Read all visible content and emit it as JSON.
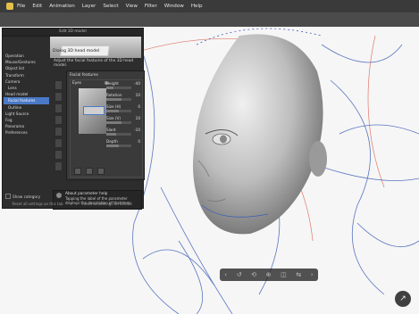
{
  "menu": [
    "File",
    "Edit",
    "Animation",
    "Layer",
    "Select",
    "View",
    "Filter",
    "Window",
    "Help"
  ],
  "dialog": {
    "title": "Edit 3D model",
    "preview_caption": "Dialog 3D head model",
    "description": "Adjust the facial features of the 3D head model.",
    "categories": [
      {
        "label": "Operation",
        "sub": false
      },
      {
        "label": "Mouse/Gestures",
        "sub": false
      },
      {
        "label": "Object list",
        "sub": false
      },
      {
        "label": "Transform",
        "sub": false
      },
      {
        "label": "Camera",
        "sub": false
      },
      {
        "label": "Lens",
        "sub": true
      },
      {
        "label": "Head model",
        "sub": false
      },
      {
        "label": "Facial features",
        "sub": true,
        "selected": true
      },
      {
        "label": "Outline",
        "sub": true
      },
      {
        "label": "Light Source",
        "sub": false
      },
      {
        "label": "Fog",
        "sub": false
      },
      {
        "label": "Panorama",
        "sub": false
      },
      {
        "label": "Preferences",
        "sub": false
      }
    ],
    "facial_features_title": "Facial features",
    "eyes_title": "Eyes",
    "properties": [
      {
        "label": "Height",
        "value": "-40",
        "level": 0.3
      },
      {
        "label": "Rotation",
        "value": "10",
        "level": 0.6
      },
      {
        "label": "Size (H)",
        "value": "0",
        "level": 0.5
      },
      {
        "label": "Size (V)",
        "value": "10",
        "level": 0.6
      },
      {
        "label": "Slant",
        "value": "-10",
        "level": 0.4
      },
      {
        "label": "Depth",
        "value": "0",
        "level": 0.5
      }
    ],
    "about_title": "About parameter help",
    "about_text": "Tapping the label of the parameter displays the description of that item.",
    "show_category": "Show category",
    "reset_button": "Reset all settings on this tab",
    "reset_all_button": "Reset all settings on default"
  },
  "canvas_tools": [
    "‹",
    "↺",
    "⟲",
    "⊕",
    "◫",
    "⇆",
    "›"
  ],
  "corner_button_icon": "↗"
}
